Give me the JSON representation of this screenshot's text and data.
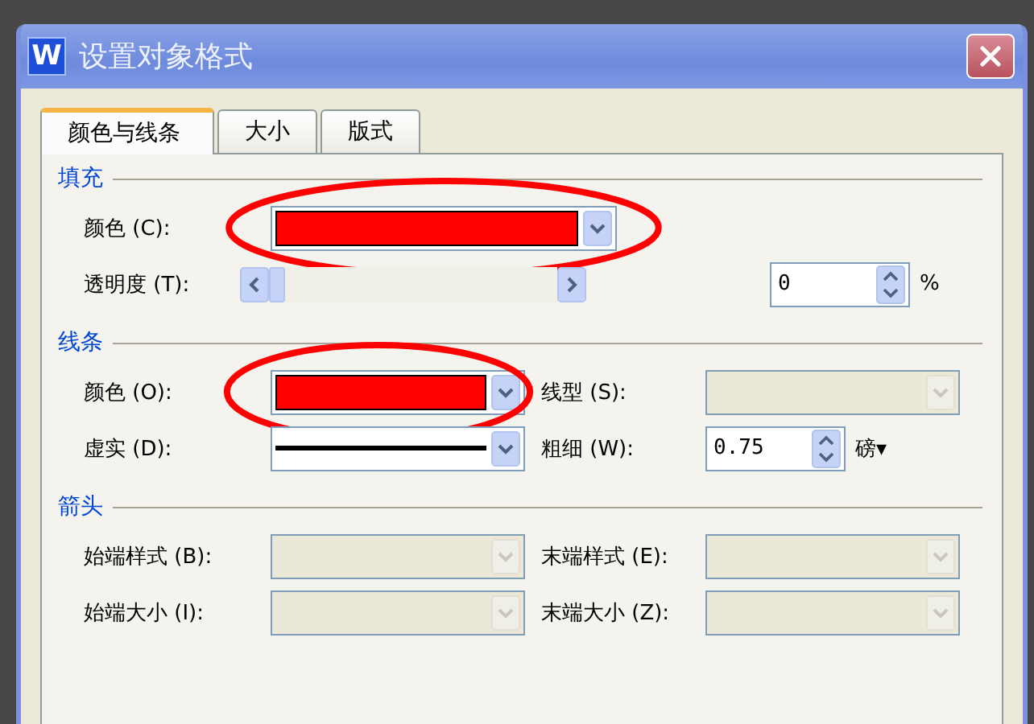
{
  "window": {
    "icon_letter": "W",
    "title": "设置对象格式"
  },
  "tabs": [
    {
      "label": "颜色与线条",
      "selected": true
    },
    {
      "label": "大小",
      "selected": false
    },
    {
      "label": "版式",
      "selected": false
    }
  ],
  "sections": [
    {
      "title": "填充",
      "rows": [
        {
          "label": "颜色 (C):",
          "control": {
            "kind": "color",
            "color": "#ff0000",
            "circled": true
          }
        },
        {
          "label": "透明度 (T):",
          "control": {
            "kind": "slider",
            "level": 0
          },
          "right": {
            "control": {
              "kind": "spin",
              "value": "0",
              "unit": "%"
            }
          }
        }
      ]
    },
    {
      "title": "线条",
      "rows": [
        {
          "label": "颜色 (O):",
          "control": {
            "kind": "color",
            "color": "#ff0000",
            "circled": true
          },
          "right": {
            "label": "线型 (S):",
            "control": {
              "kind": "combo",
              "disabled": true
            }
          }
        },
        {
          "label": "虚实 (D):",
          "control": {
            "kind": "line"
          },
          "right": {
            "label": "粗细 (W):",
            "control": {
              "kind": "spin",
              "value": "0.75",
              "unit": "磅▾"
            }
          }
        }
      ]
    },
    {
      "title": "箭头",
      "rows": [
        {
          "label": "始端样式 (B):",
          "control": {
            "kind": "combo",
            "disabled": true
          },
          "right": {
            "label": "末端样式 (E):",
            "control": {
              "kind": "combo",
              "disabled": true
            }
          }
        },
        {
          "label": "始端大小 (I):",
          "control": {
            "kind": "combo",
            "disabled": true
          },
          "right": {
            "label": "末端大小 (Z):",
            "control": {
              "kind": "combo",
              "disabled": true
            }
          }
        }
      ]
    }
  ]
}
